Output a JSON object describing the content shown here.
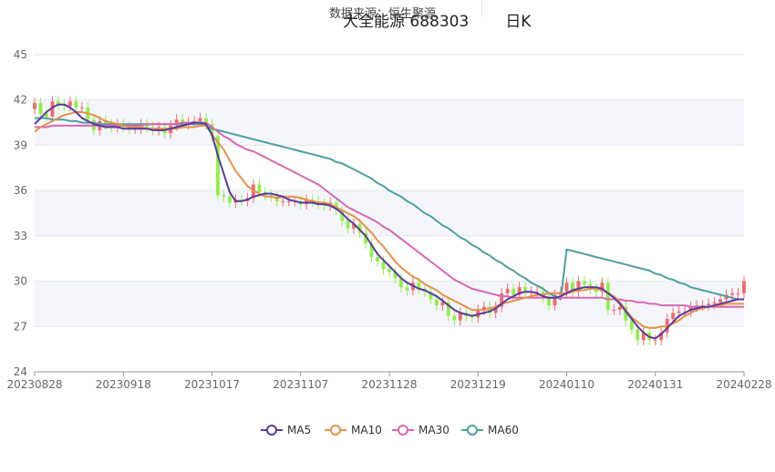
{
  "header": {
    "source_text": "数据来源：恒生聚源",
    "title": "大全能源 688303",
    "period": "日K"
  },
  "colors": {
    "up": "#ef6b6b",
    "down": "#8ff04a",
    "ma5": "#5b3a9e",
    "ma10": "#e8914a",
    "ma30": "#d868b2",
    "ma60": "#4e9fa0",
    "band": "#f5f6fb",
    "grid": "#e3e6ee"
  },
  "chart_data": {
    "type": "candlestick",
    "title": "大全能源 688303",
    "ylim": [
      24,
      45
    ],
    "y_ticks": [
      24,
      27,
      30,
      33,
      36,
      39,
      42,
      45
    ],
    "x_tick_labels": [
      "20230828",
      "20230918",
      "20231017",
      "20231107",
      "20231128",
      "20231219",
      "20240110",
      "20240131",
      "20240228"
    ],
    "x_tick_index": [
      0,
      15,
      30,
      45,
      60,
      75,
      90,
      105,
      120
    ],
    "grid": true,
    "legend_position": "bottom",
    "series": [
      {
        "name": "MA5",
        "key": "ma5"
      },
      {
        "name": "MA10",
        "key": "ma10"
      },
      {
        "name": "MA30",
        "key": "ma30"
      },
      {
        "name": "MA60",
        "key": "ma60"
      }
    ],
    "candles_close": [
      41.8,
      41.1,
      40.9,
      41.9,
      41.7,
      41.6,
      41.9,
      41.5,
      41.5,
      40.7,
      40.0,
      40.6,
      40.4,
      40.2,
      40.4,
      40.2,
      40.1,
      40.1,
      40.4,
      40.2,
      40.0,
      40.2,
      39.8,
      40.3,
      40.7,
      40.4,
      40.5,
      40.6,
      40.8,
      40.4,
      39.6,
      35.7,
      35.6,
      35.2,
      35.4,
      35.3,
      35.5,
      36.4,
      35.9,
      35.7,
      35.6,
      35.3,
      35.3,
      35.3,
      35.3,
      35.1,
      35.4,
      35.3,
      35.1,
      35.0,
      35.2,
      34.7,
      34.0,
      33.5,
      33.8,
      33.2,
      32.5,
      31.6,
      31.3,
      30.8,
      30.6,
      30.2,
      29.6,
      29.4,
      29.9,
      29.5,
      29.3,
      28.8,
      28.4,
      28.6,
      27.7,
      27.4,
      27.9,
      27.7,
      27.6,
      28.1,
      28.3,
      27.9,
      28.3,
      29.2,
      29.5,
      29.1,
      29.6,
      29.3,
      29.3,
      29.3,
      28.9,
      28.4,
      29.1,
      29.3,
      29.9,
      29.3,
      30.0,
      29.8,
      29.5,
      29.3,
      29.9,
      28.1,
      28.1,
      28.3,
      27.4,
      26.8,
      26.1,
      26.6,
      26.1,
      26.1,
      26.6,
      27.5,
      27.9,
      28.0,
      28.0,
      28.3,
      28.4,
      28.4,
      28.5,
      28.6,
      28.8,
      29.1,
      29.2,
      29.2,
      30.0
    ],
    "ma5": [
      40.4,
      40.8,
      41.2,
      41.5,
      41.7,
      41.7,
      41.5,
      41.2,
      40.8,
      40.6,
      40.4,
      40.3,
      40.2,
      40.2,
      40.2,
      40.1,
      40.1,
      40.1,
      40.1,
      40.1,
      40.0,
      40.0,
      40.0,
      40.1,
      40.2,
      40.3,
      40.4,
      40.5,
      40.5,
      40.4,
      39.7,
      38.3,
      37.1,
      35.9,
      35.3,
      35.3,
      35.4,
      35.6,
      35.7,
      35.8,
      35.8,
      35.7,
      35.6,
      35.4,
      35.3,
      35.2,
      35.2,
      35.2,
      35.1,
      35.1,
      35.0,
      34.8,
      34.5,
      34.1,
      33.8,
      33.4,
      33.0,
      32.4,
      31.8,
      31.4,
      31.0,
      30.6,
      30.2,
      29.9,
      29.7,
      29.5,
      29.4,
      29.2,
      29.0,
      28.7,
      28.4,
      28.1,
      27.9,
      27.8,
      27.7,
      27.8,
      27.9,
      28.0,
      28.2,
      28.5,
      28.8,
      29.0,
      29.2,
      29.3,
      29.3,
      29.2,
      29.0,
      28.9,
      28.9,
      29.0,
      29.2,
      29.4,
      29.5,
      29.6,
      29.6,
      29.6,
      29.5,
      29.2,
      28.9,
      28.5,
      28.0,
      27.5,
      27.0,
      26.6,
      26.3,
      26.2,
      26.5,
      26.9,
      27.3,
      27.7,
      27.9,
      28.1,
      28.2,
      28.3,
      28.3,
      28.4,
      28.5,
      28.6,
      28.7,
      28.8,
      28.8
    ],
    "ma10": [
      39.9,
      40.2,
      40.4,
      40.6,
      40.8,
      41.0,
      41.1,
      41.2,
      41.2,
      41.1,
      41.0,
      40.8,
      40.6,
      40.5,
      40.4,
      40.3,
      40.2,
      40.2,
      40.2,
      40.1,
      40.1,
      40.1,
      40.1,
      40.1,
      40.1,
      40.2,
      40.2,
      40.2,
      40.3,
      40.3,
      39.7,
      39.2,
      38.7,
      38.0,
      37.3,
      36.8,
      36.3,
      36.0,
      35.8,
      35.6,
      35.6,
      35.5,
      35.6,
      35.6,
      35.6,
      35.5,
      35.4,
      35.3,
      35.2,
      35.2,
      35.1,
      34.9,
      34.7,
      34.5,
      34.3,
      34.0,
      33.6,
      33.2,
      32.7,
      32.3,
      31.8,
      31.3,
      30.9,
      30.6,
      30.3,
      30.1,
      29.8,
      29.6,
      29.4,
      29.1,
      28.9,
      28.7,
      28.5,
      28.3,
      28.1,
      28.1,
      28.1,
      28.2,
      28.3,
      28.5,
      28.6,
      28.7,
      28.8,
      28.9,
      29.0,
      29.1,
      29.1,
      29.2,
      29.2,
      29.2,
      29.2,
      29.3,
      29.4,
      29.4,
      29.5,
      29.5,
      29.4,
      29.2,
      29.0,
      28.6,
      28.1,
      27.6,
      27.3,
      27.0,
      26.9,
      26.9,
      27.0,
      27.0,
      27.2,
      27.4,
      27.7,
      27.9,
      28.1,
      28.2,
      28.3,
      28.4,
      28.4,
      28.5,
      28.5,
      28.5,
      28.5
    ],
    "ma30": [
      40.2,
      40.2,
      40.2,
      40.3,
      40.3,
      40.3,
      40.3,
      40.3,
      40.3,
      40.3,
      40.3,
      40.3,
      40.3,
      40.3,
      40.3,
      40.3,
      40.3,
      40.3,
      40.3,
      40.4,
      40.4,
      40.4,
      40.4,
      40.4,
      40.4,
      40.5,
      40.5,
      40.5,
      40.5,
      40.5,
      40.2,
      39.9,
      39.6,
      39.4,
      39.1,
      38.9,
      38.7,
      38.6,
      38.4,
      38.2,
      38.0,
      37.8,
      37.6,
      37.4,
      37.2,
      37.0,
      36.8,
      36.6,
      36.4,
      36.1,
      35.8,
      35.5,
      35.2,
      34.9,
      34.7,
      34.5,
      34.3,
      34.1,
      33.9,
      33.6,
      33.4,
      33.1,
      32.8,
      32.5,
      32.2,
      31.9,
      31.6,
      31.3,
      31.0,
      30.7,
      30.4,
      30.1,
      29.9,
      29.7,
      29.5,
      29.4,
      29.3,
      29.2,
      29.1,
      29.0,
      29.0,
      28.9,
      28.9,
      28.9,
      28.9,
      28.9,
      28.9,
      28.9,
      28.9,
      28.9,
      28.9,
      28.9,
      28.9,
      28.9,
      28.9,
      28.9,
      28.9,
      28.8,
      28.8,
      28.8,
      28.7,
      28.7,
      28.6,
      28.6,
      28.5,
      28.5,
      28.4,
      28.4,
      28.4,
      28.4,
      28.4,
      28.3,
      28.3,
      28.3,
      28.3,
      28.3,
      28.3,
      28.3,
      28.3,
      28.3,
      28.3
    ],
    "ma60": [
      40.8,
      40.8,
      40.8,
      40.7,
      40.7,
      40.7,
      40.6,
      40.6,
      40.5,
      40.5,
      40.5,
      40.4,
      40.4,
      40.4,
      40.4,
      40.4,
      40.4,
      40.4,
      40.4,
      40.4,
      40.4,
      40.4,
      40.4,
      40.4,
      40.4,
      40.4,
      40.4,
      40.4,
      40.4,
      40.3,
      40.1,
      40.0,
      39.9,
      39.8,
      39.7,
      39.6,
      39.5,
      39.4,
      39.3,
      39.2,
      39.1,
      39.0,
      38.9,
      38.8,
      38.7,
      38.6,
      38.5,
      38.4,
      38.3,
      38.2,
      38.1,
      37.9,
      37.8,
      37.6,
      37.4,
      37.2,
      37.0,
      36.8,
      36.5,
      36.3,
      36.0,
      35.8,
      35.6,
      35.3,
      35.1,
      34.8,
      34.5,
      34.3,
      34.0,
      33.7,
      33.5,
      33.2,
      32.9,
      32.7,
      32.4,
      32.2,
      31.9,
      31.7,
      31.4,
      31.2,
      30.9,
      30.7,
      30.4,
      30.2,
      29.9,
      29.7,
      29.5,
      29.2,
      29.0,
      28.8,
      32.1,
      32.0,
      31.9,
      31.8,
      31.7,
      31.6,
      31.5,
      31.4,
      31.3,
      31.2,
      31.1,
      31.0,
      30.9,
      30.8,
      30.7,
      30.5,
      30.4,
      30.2,
      30.1,
      29.9,
      29.8,
      29.6,
      29.5,
      29.4,
      29.3,
      29.2,
      29.1,
      29.0,
      28.9,
      28.8,
      28.8
    ]
  }
}
